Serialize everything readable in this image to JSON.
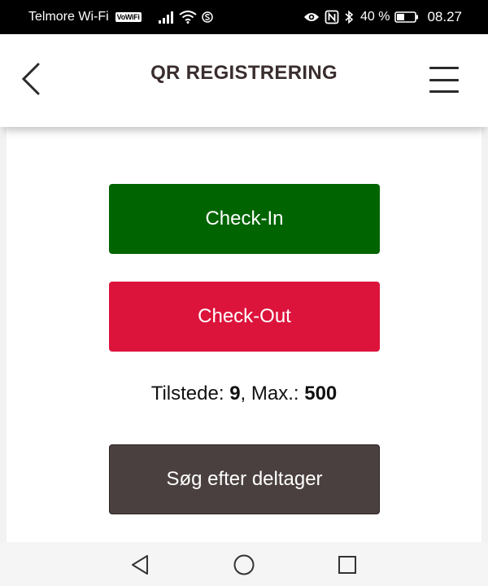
{
  "status_bar": {
    "carrier": "Telmore Wi-Fi",
    "vowifi": "VoWiFi",
    "battery_percent": "40 %",
    "time": "08.27"
  },
  "header": {
    "title": "QR REGISTRERING"
  },
  "actions": {
    "check_in_label": "Check-In",
    "check_out_label": "Check-Out",
    "search_label": "Søg efter deltager"
  },
  "attendance": {
    "present_label": "Tilstede: ",
    "present_value": "9",
    "max_label": ", Max.: ",
    "max_value": "500"
  },
  "colors": {
    "check_in": "#006400",
    "check_out": "#dc143c",
    "search": "#4a403f",
    "title": "#3a2e2e"
  },
  "icons": {
    "back": "chevron-left-icon",
    "menu": "hamburger-menu-icon",
    "nav_back": "triangle-back-icon",
    "nav_home": "circle-home-icon",
    "nav_recents": "square-recents-icon"
  }
}
